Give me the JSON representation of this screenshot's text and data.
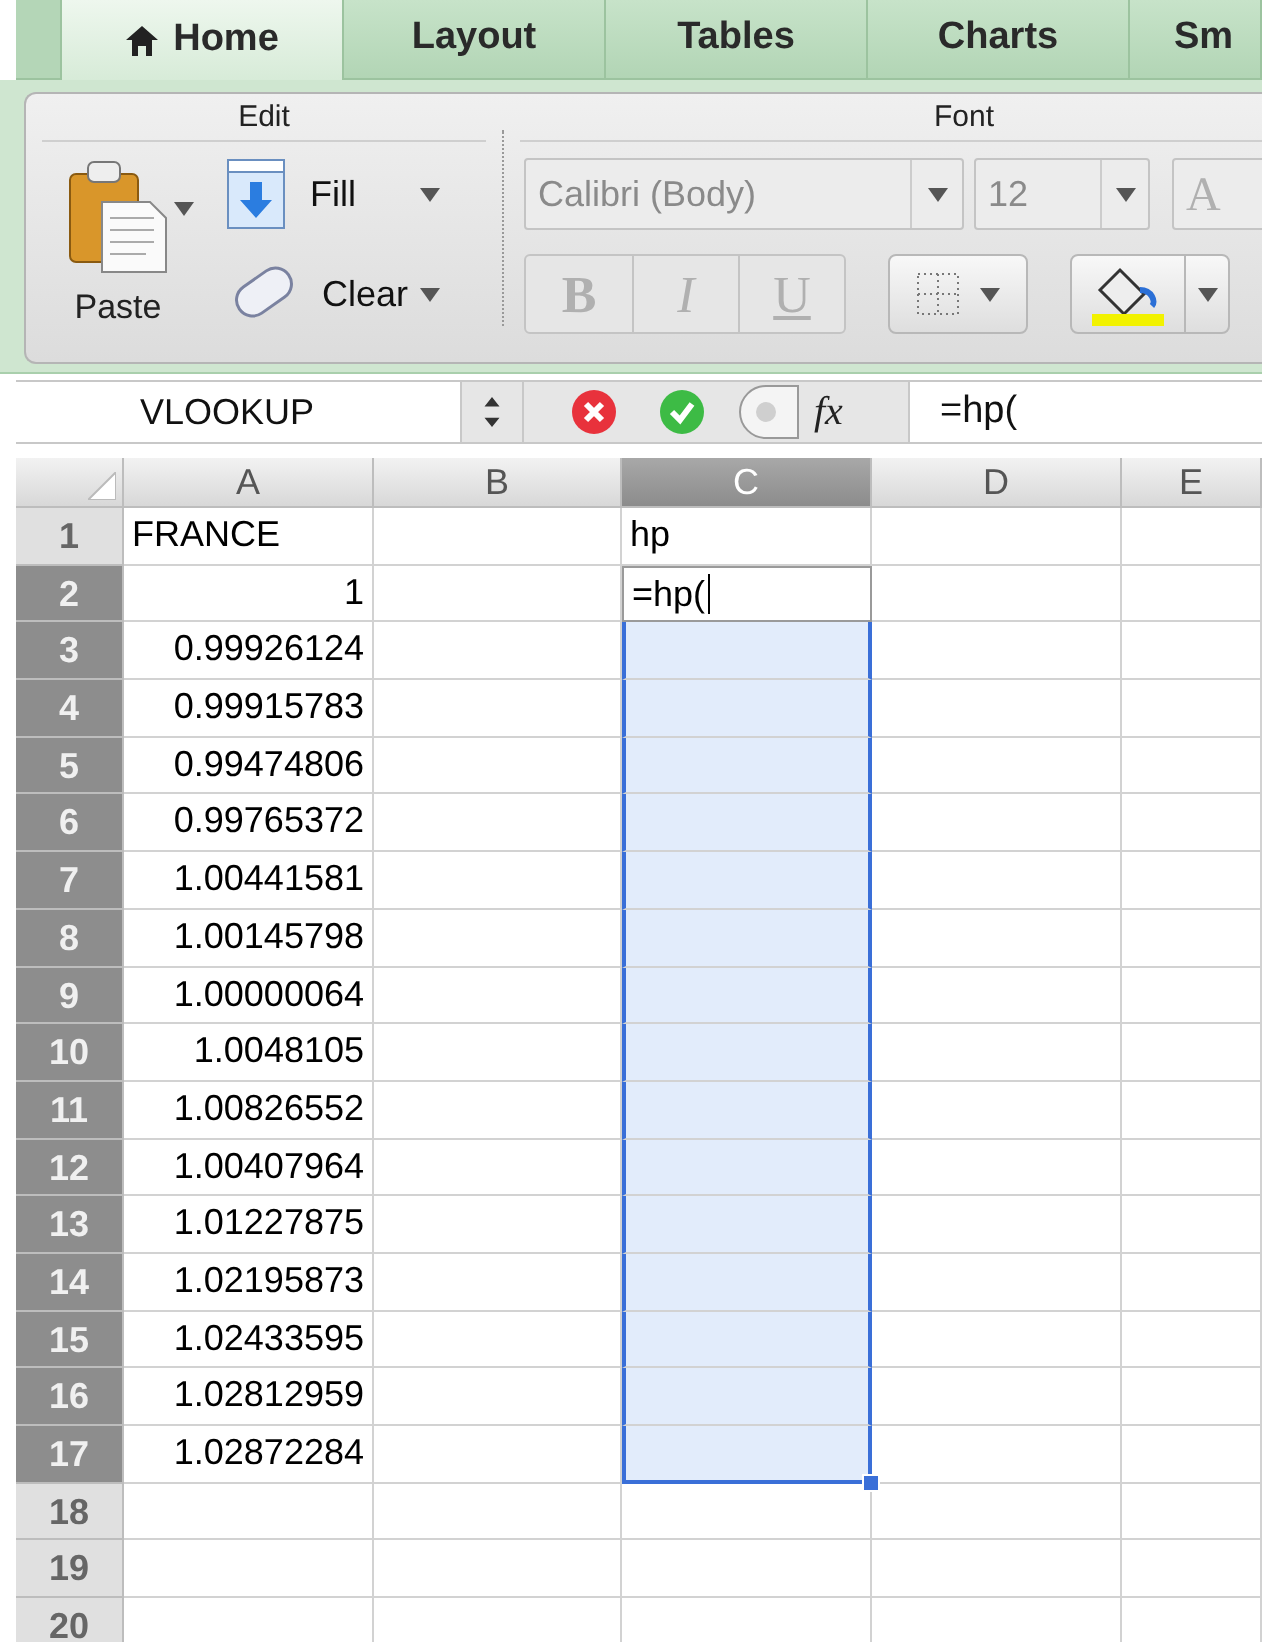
{
  "tabs": [
    {
      "label": "Home",
      "selected": true,
      "kind": "home"
    },
    {
      "label": "Layout",
      "selected": false
    },
    {
      "label": "Tables",
      "selected": false
    },
    {
      "label": "Charts",
      "selected": false
    },
    {
      "label": "Sm",
      "selected": false
    }
  ],
  "edit_group": {
    "title": "Edit",
    "paste": "Paste",
    "fill": "Fill",
    "clear": "Clear"
  },
  "font_group": {
    "title": "Font",
    "disabled": true,
    "font_name": "Calibri (Body)",
    "font_size": "12",
    "grow_font": "A",
    "bold": "B",
    "italic": "I",
    "underline": "U"
  },
  "formula_bar": {
    "name_box": "VLOOKUP",
    "fx": "fx",
    "formula": "=hp("
  },
  "sheet": {
    "columns": [
      {
        "label": "A",
        "selected": false
      },
      {
        "label": "B",
        "selected": false
      },
      {
        "label": "C",
        "selected": true
      },
      {
        "label": "D",
        "selected": false
      },
      {
        "label": "E",
        "selected": false
      }
    ],
    "rows": [
      {
        "label": "1",
        "selected": false,
        "a": {
          "text": "FRANCE",
          "kind": "text"
        },
        "c": {
          "text": "hp",
          "kind": "text"
        }
      },
      {
        "label": "2",
        "selected": true,
        "a": {
          "text": "1",
          "kind": "number"
        },
        "c": {
          "text": "=hp(",
          "kind": "editor"
        }
      },
      {
        "label": "3",
        "selected": true,
        "a": {
          "text": "0.99926124",
          "kind": "number"
        }
      },
      {
        "label": "4",
        "selected": true,
        "a": {
          "text": "0.99915783",
          "kind": "number"
        }
      },
      {
        "label": "5",
        "selected": true,
        "a": {
          "text": "0.99474806",
          "kind": "number"
        }
      },
      {
        "label": "6",
        "selected": true,
        "a": {
          "text": "0.99765372",
          "kind": "number"
        }
      },
      {
        "label": "7",
        "selected": true,
        "a": {
          "text": "1.00441581",
          "kind": "number"
        }
      },
      {
        "label": "8",
        "selected": true,
        "a": {
          "text": "1.00145798",
          "kind": "number"
        }
      },
      {
        "label": "9",
        "selected": true,
        "a": {
          "text": "1.00000064",
          "kind": "number"
        }
      },
      {
        "label": "10",
        "selected": true,
        "a": {
          "text": "1.0048105",
          "kind": "number"
        }
      },
      {
        "label": "11",
        "selected": true,
        "a": {
          "text": "1.00826552",
          "kind": "number"
        }
      },
      {
        "label": "12",
        "selected": true,
        "a": {
          "text": "1.00407964",
          "kind": "number"
        }
      },
      {
        "label": "13",
        "selected": true,
        "a": {
          "text": "1.01227875",
          "kind": "number"
        }
      },
      {
        "label": "14",
        "selected": true,
        "a": {
          "text": "1.02195873",
          "kind": "number"
        }
      },
      {
        "label": "15",
        "selected": true,
        "a": {
          "text": "1.02433595",
          "kind": "number"
        }
      },
      {
        "label": "16",
        "selected": true,
        "a": {
          "text": "1.02812959",
          "kind": "number"
        }
      },
      {
        "label": "17",
        "selected": true,
        "a": {
          "text": "1.02872284",
          "kind": "number"
        }
      },
      {
        "label": "18",
        "selected": false
      },
      {
        "label": "19",
        "selected": false
      },
      {
        "label": "20",
        "selected": false
      }
    ]
  }
}
